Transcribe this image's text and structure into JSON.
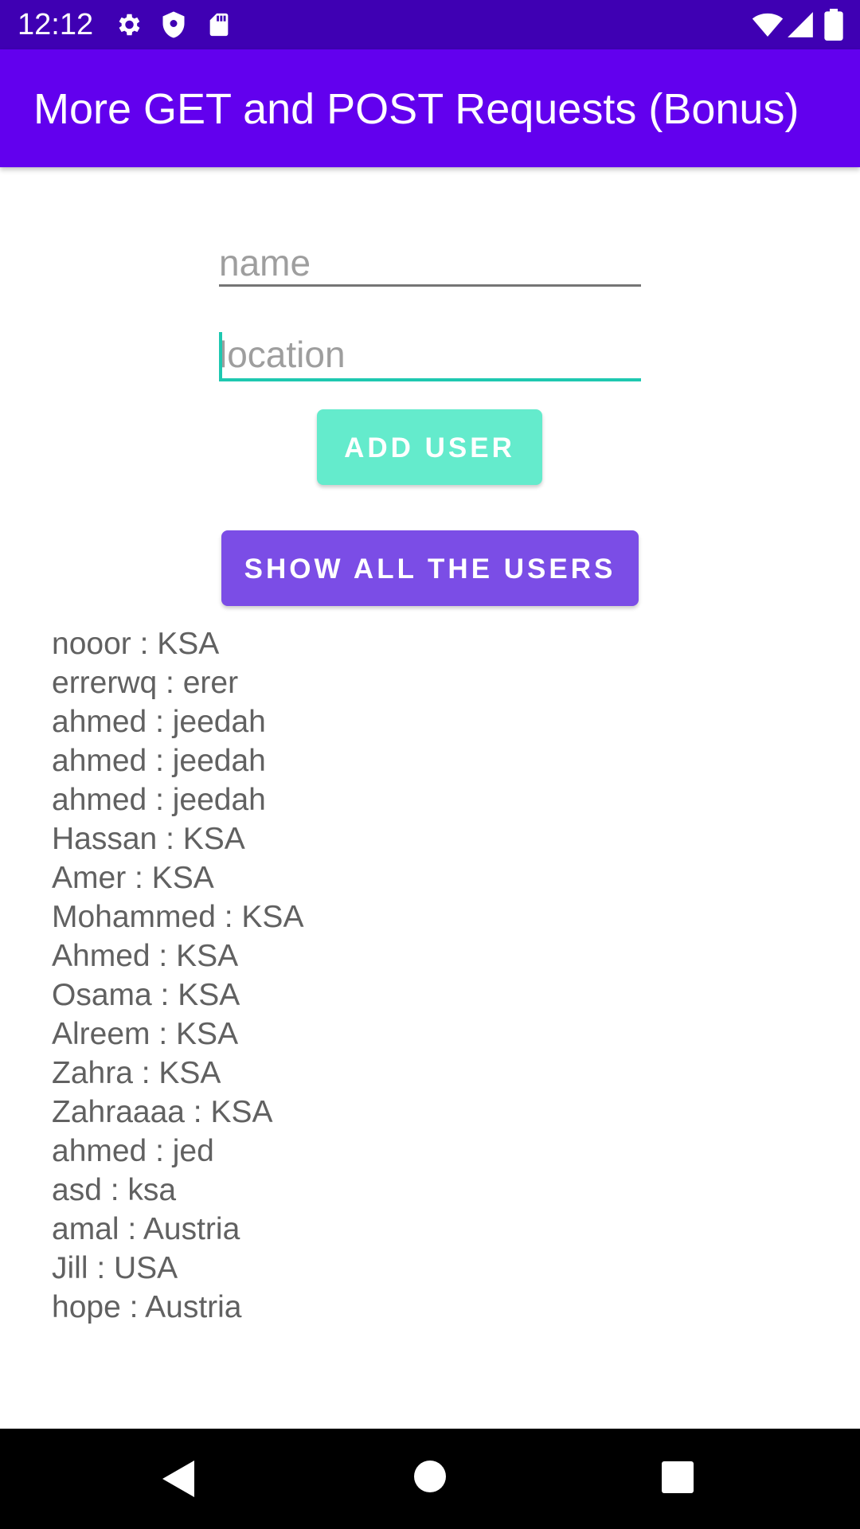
{
  "status_bar": {
    "time": "12:12",
    "icons": [
      "gear-icon",
      "shield-icon",
      "sd-card-icon",
      "wifi-icon",
      "signal-icon",
      "battery-icon"
    ]
  },
  "app_bar": {
    "title": "More GET and POST Requests (Bonus)"
  },
  "form": {
    "name_placeholder": "name",
    "name_value": "",
    "location_placeholder": "location",
    "location_value": "",
    "add_button_label": "ADD USER",
    "show_button_label": "SHOW ALL THE USERS"
  },
  "users": [
    "nooor : KSA",
    "errerwq : erer",
    "ahmed : jeedah",
    "ahmed : jeedah",
    "ahmed : jeedah",
    "Hassan : KSA",
    "Amer : KSA",
    "Mohammed : KSA",
    "Ahmed : KSA",
    "Osama : KSA",
    "Alreem : KSA",
    "Zahra : KSA",
    "Zahraaaa : KSA",
    "ahmed : jed",
    "asd : ksa",
    "amal : Austria",
    "Jill : USA",
    "hope : Austria"
  ],
  "nav_bar": {
    "icons": [
      "back-icon",
      "home-icon",
      "recents-icon"
    ]
  },
  "colors": {
    "status_bar": "#3f00b3",
    "app_bar": "#6200ee",
    "add_button": "#64ebcc",
    "show_button": "#7b4de6",
    "accent": "#1ec8b0",
    "list_text": "#616161"
  }
}
